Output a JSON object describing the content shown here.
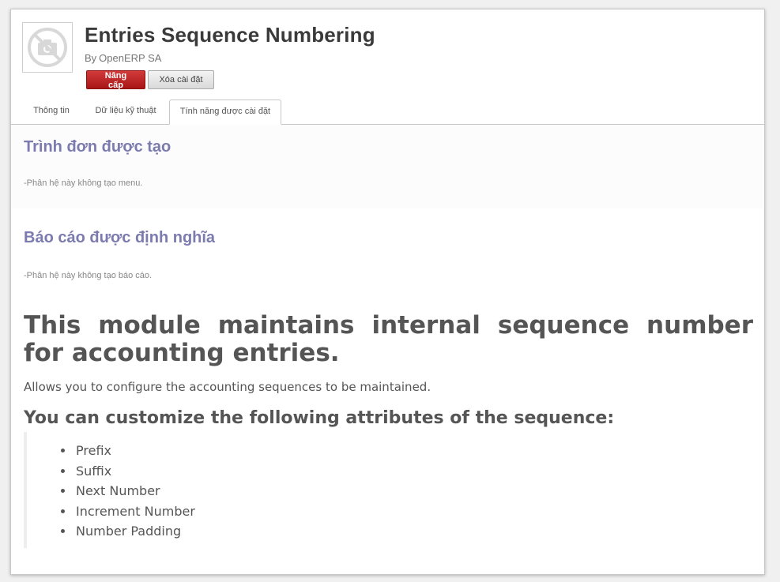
{
  "module": {
    "title": "Entries Sequence Numbering",
    "author_prefix": "By",
    "author": "OpenERP SA",
    "icon": "camera-off-icon"
  },
  "buttons": {
    "upgrade": "Nâng cấp",
    "uninstall": "Xóa cài đặt"
  },
  "tabs": [
    {
      "label": "Thông tin"
    },
    {
      "label": "Dữ liệu kỹ thuật"
    },
    {
      "label": "Tính năng được cài đặt",
      "active": true
    }
  ],
  "sections": {
    "menus": {
      "title": "Trình đơn được tạo",
      "note": "-Phân hệ này không tạo menu."
    },
    "reports": {
      "title": "Báo cáo được định nghĩa",
      "note": "-Phân hệ này không tạo báo cáo."
    }
  },
  "description": {
    "heading": "This module maintains internal sequence number for accounting entries.",
    "text": "Allows you to configure the accounting sequences to be maintained.",
    "subheading": "You can customize the following attributes of the sequence:",
    "items": [
      "Prefix",
      "Suffix",
      "Next Number",
      "Increment Number",
      "Number Padding"
    ]
  },
  "colors": {
    "section_title": "#7b7bb0",
    "upgrade_button": "#b81f1f"
  }
}
